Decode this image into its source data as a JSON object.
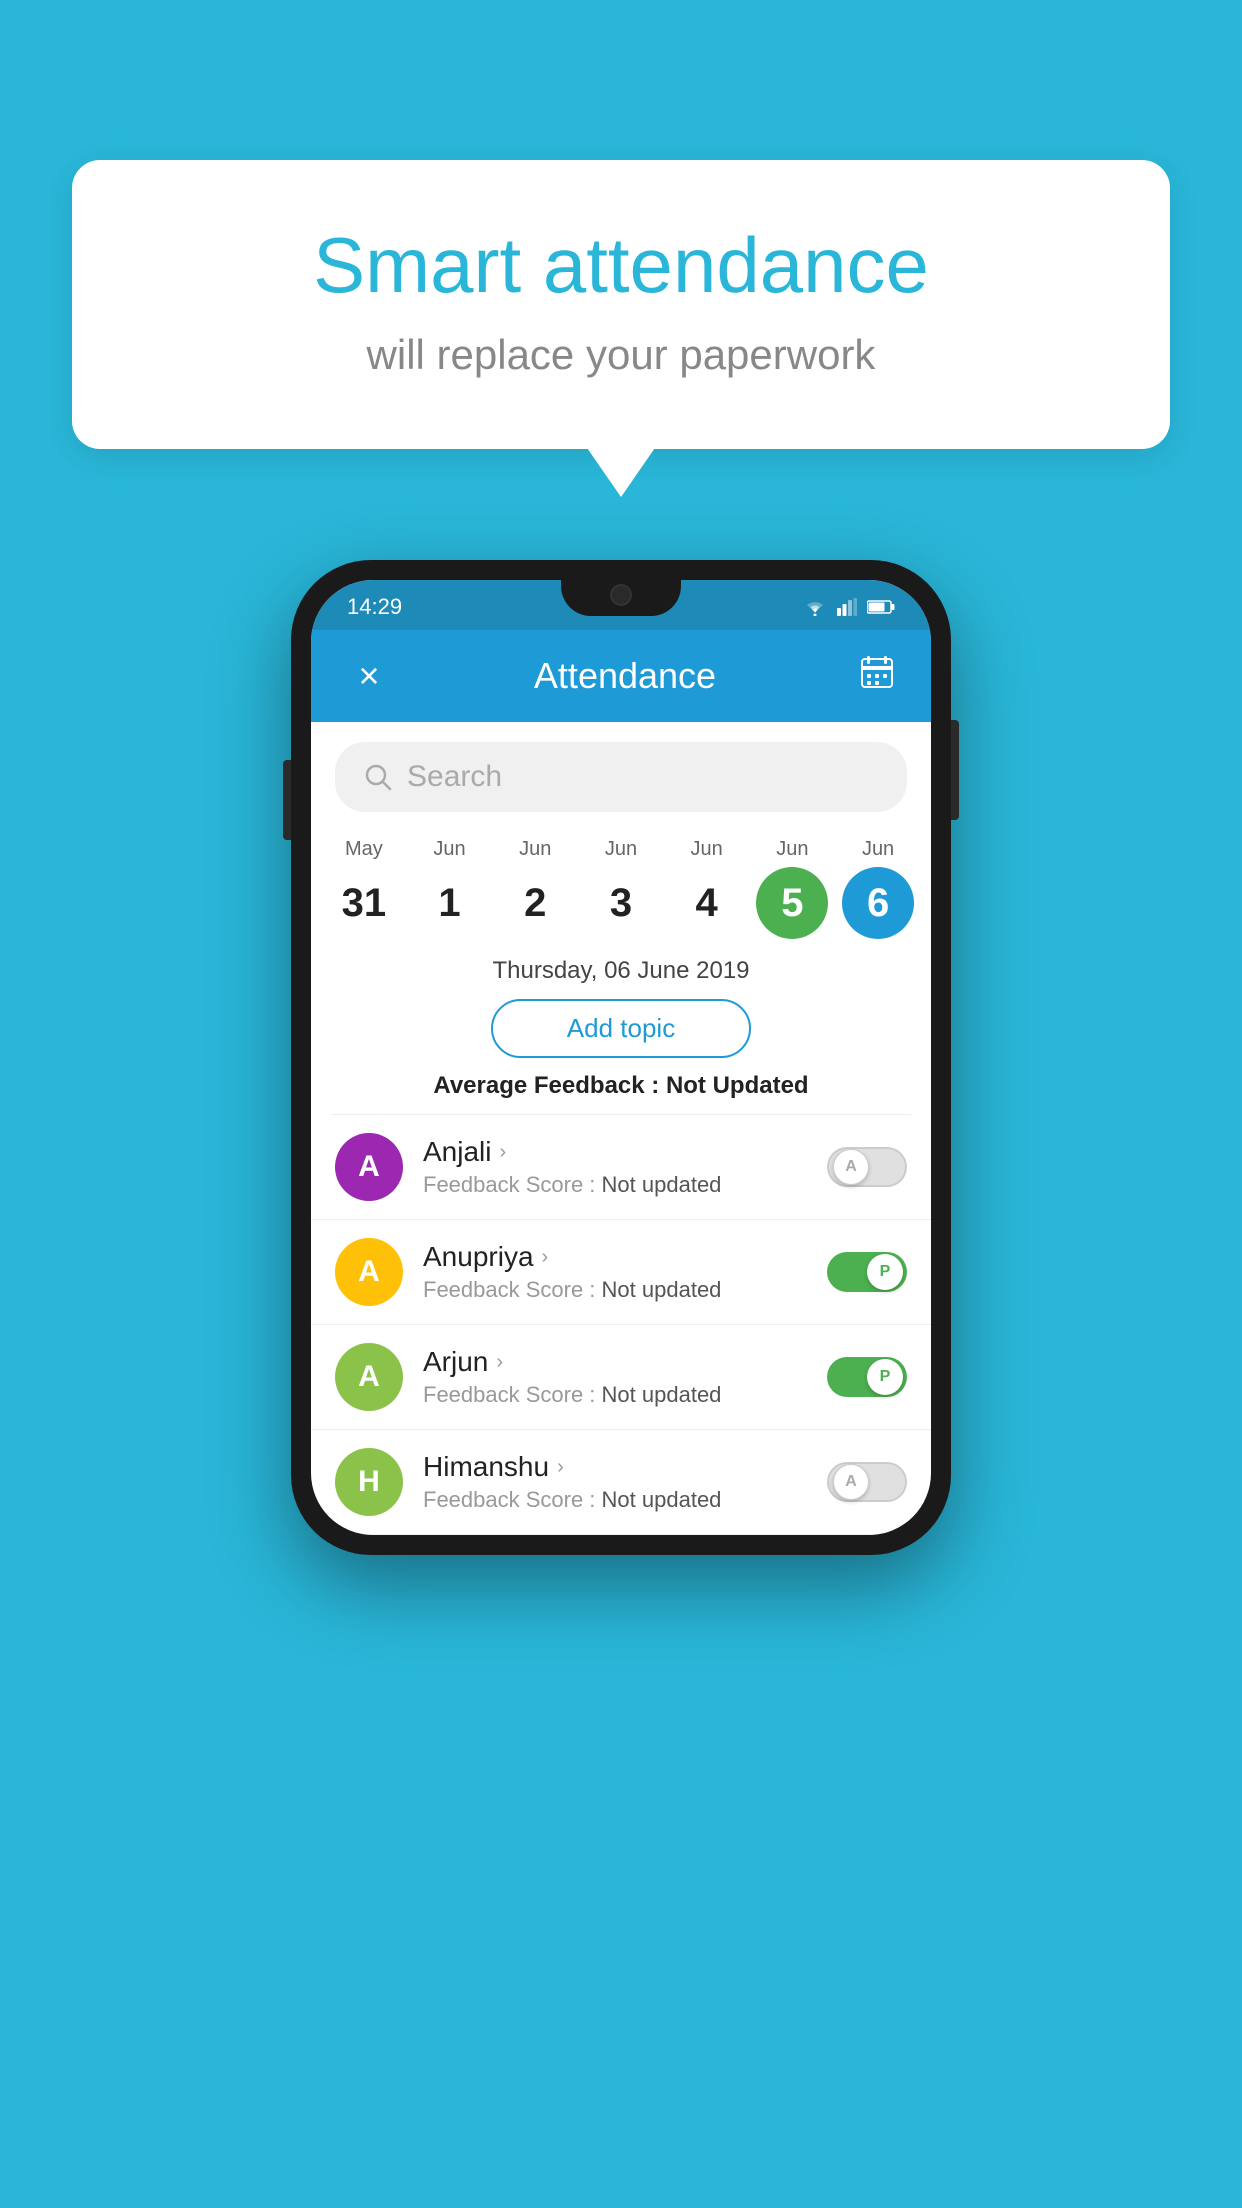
{
  "background_color": "#29b6d8",
  "bubble": {
    "title": "Smart attendance",
    "subtitle": "will replace your paperwork"
  },
  "status_bar": {
    "time": "14:29",
    "icons": [
      "wifi",
      "signal",
      "battery"
    ]
  },
  "header": {
    "title": "Attendance",
    "close_label": "×",
    "calendar_label": "📅"
  },
  "search": {
    "placeholder": "Search"
  },
  "calendar": {
    "days": [
      {
        "month": "May",
        "date": "31",
        "state": "normal"
      },
      {
        "month": "Jun",
        "date": "1",
        "state": "normal"
      },
      {
        "month": "Jun",
        "date": "2",
        "state": "normal"
      },
      {
        "month": "Jun",
        "date": "3",
        "state": "normal"
      },
      {
        "month": "Jun",
        "date": "4",
        "state": "normal"
      },
      {
        "month": "Jun",
        "date": "5",
        "state": "today"
      },
      {
        "month": "Jun",
        "date": "6",
        "state": "selected"
      }
    ]
  },
  "selected_date": "Thursday, 06 June 2019",
  "add_topic_label": "Add topic",
  "avg_feedback_label": "Average Feedback : ",
  "avg_feedback_value": "Not Updated",
  "students": [
    {
      "name": "Anjali",
      "avatar_letter": "A",
      "avatar_color": "#9c27b0",
      "feedback_label": "Feedback Score : ",
      "feedback_value": "Not updated",
      "toggle_state": "off",
      "toggle_letter": "A"
    },
    {
      "name": "Anupriya",
      "avatar_letter": "A",
      "avatar_color": "#ffc107",
      "feedback_label": "Feedback Score : ",
      "feedback_value": "Not updated",
      "toggle_state": "on",
      "toggle_letter": "P"
    },
    {
      "name": "Arjun",
      "avatar_letter": "A",
      "avatar_color": "#8bc34a",
      "feedback_label": "Feedback Score : ",
      "feedback_value": "Not updated",
      "toggle_state": "on",
      "toggle_letter": "P"
    },
    {
      "name": "Himanshu",
      "avatar_letter": "H",
      "avatar_color": "#8bc34a",
      "feedback_label": "Feedback Score : ",
      "feedback_value": "Not updated",
      "toggle_state": "off",
      "toggle_letter": "A"
    }
  ]
}
